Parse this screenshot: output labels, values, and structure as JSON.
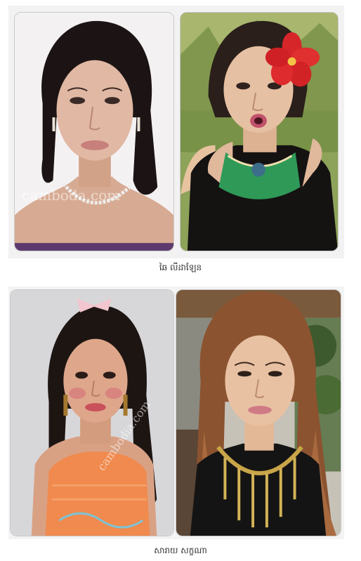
{
  "pairs": [
    {
      "caption": "ឆៃ លីដាឡែន",
      "photos": [
        {
          "label": "portrait-before",
          "watermark": "camboda.com"
        },
        {
          "label": "portrait-after",
          "watermark": ""
        }
      ]
    },
    {
      "caption": "សារាយ សក្ខណា",
      "photos": [
        {
          "label": "portrait-before",
          "watermark": "cambodia.com"
        },
        {
          "label": "portrait-after",
          "watermark": ""
        }
      ]
    }
  ],
  "colors": {
    "panel_bg": "#f2f2f2",
    "caption_text": "#333333",
    "photo_border": "#c9c9c9"
  }
}
